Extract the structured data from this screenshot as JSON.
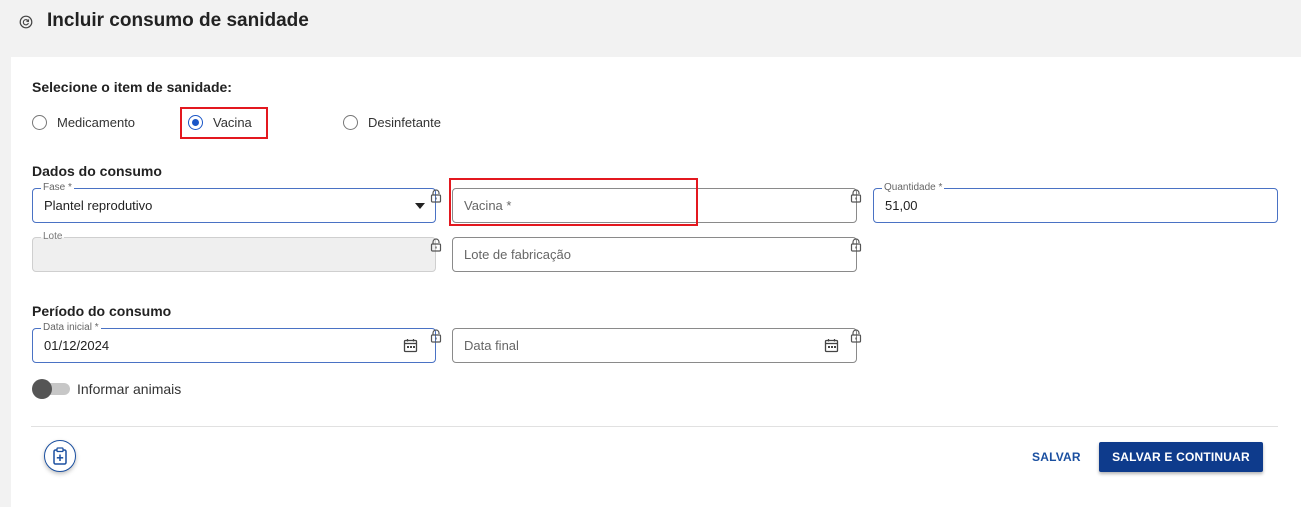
{
  "header": {
    "title": "Incluir consumo de sanidade"
  },
  "item_section": {
    "title": "Selecione o item de sanidade:",
    "options": [
      {
        "label": "Medicamento",
        "checked": false
      },
      {
        "label": "Vacina",
        "checked": true
      },
      {
        "label": "Desinfetante",
        "checked": false
      }
    ]
  },
  "consumo_section": {
    "title": "Dados do consumo",
    "fase": {
      "label": "Fase *",
      "value": "Plantel reprodutivo"
    },
    "vacina": {
      "placeholder": "Vacina *"
    },
    "quantidade": {
      "label": "Quantidade *",
      "value": "51,00"
    },
    "lote": {
      "label": "Lote",
      "value": ""
    },
    "lote_fabricacao": {
      "placeholder": "Lote de fabricação"
    }
  },
  "periodo_section": {
    "title": "Período do consumo",
    "data_inicial": {
      "label": "Data inicial *",
      "value": "01/12/2024"
    },
    "data_final": {
      "placeholder": "Data final"
    }
  },
  "toggle": {
    "label": "Informar animais",
    "on": false
  },
  "actions": {
    "save": "SALVAR",
    "save_continue": "SALVAR E CONTINUAR"
  },
  "colors": {
    "accent": "#1a56c7",
    "primary_button": "#0e3b8c",
    "highlight": "#e3181f"
  },
  "icons": [
    "back-circle-icon",
    "lock-icon",
    "calendar-icon",
    "clipboard-add-icon",
    "dropdown-caret-icon"
  ]
}
